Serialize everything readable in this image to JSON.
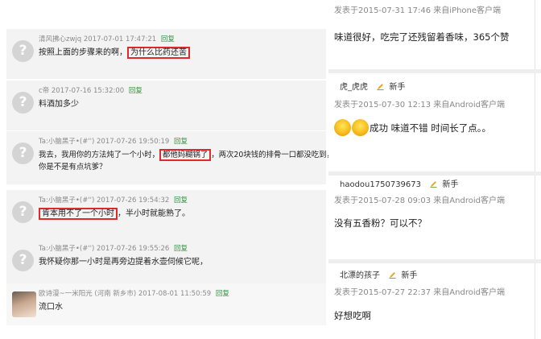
{
  "left": {
    "comments": [
      {
        "user": "清风拂心zwjq",
        "time": "2017-07-01 17:47:21",
        "reply": "回复",
        "text_before": "按照上面的步骤来的啊，",
        "highlight": "为什么比药还苦",
        "text_after": "",
        "text_line2": ""
      },
      {
        "user": "c帝",
        "time": "2017-07-16 15:32:00",
        "reply": "回复",
        "text_before": "料酒加多少",
        "highlight": "",
        "text_after": "",
        "text_line2": ""
      },
      {
        "user": "Ta:小脑黑子•(#'')",
        "time": "2017-07-26 19:50:19",
        "reply": "回复",
        "text_before": "我去，我用你的方法炖了一个小时，",
        "highlight": "都他妈糊锅了",
        "text_after": "，两次20块钱的排骨一口都没吃到，",
        "text_line2": "你是不是有点坑爹？"
      },
      {
        "user": "Ta:小脑黑子•(#'')",
        "time": "2017-07-26 19:54:32",
        "reply": "回复",
        "text_before": "",
        "highlight": "肯本用不了一个小时",
        "text_after": "，半小时就能熟了。",
        "text_line2": ""
      },
      {
        "user": "Ta:小脑黑子•(#'')",
        "time": "2017-07-26 19:55:26",
        "reply": "回复",
        "text_before": "我怀疑你那一小时是再旁边提着水壶伺候它呢，",
        "highlight": "",
        "text_after": "",
        "text_line2": ""
      },
      {
        "user": "欧诗漫~一米阳光 (河南 新乡市)",
        "time": "2017-08-01 11:50:59",
        "reply": "回复",
        "text_before": "流口水",
        "highlight": "",
        "text_after": "",
        "text_line2": ""
      }
    ]
  },
  "right": {
    "top": {
      "meta": "发表于2015-07-31 17:46  来自iPhone客户端",
      "text": "味道很好，吃完了还残留着香味，365个赞"
    },
    "comments": [
      {
        "user": "虎_虎虎",
        "level": "新手",
        "meta": "发表于2015-07-30 12:13  来自Android客户端",
        "text": "成功 味道不错 时间长了点。。"
      },
      {
        "user": "haodou1750739673",
        "level": "新手",
        "meta": "发表于2015-07-28 09:03  来自Android客户端",
        "text": "没有五香粉？可以不？"
      },
      {
        "user": "北漂的孩子",
        "level": "新手",
        "meta": "发表于2015-07-27 22:37  来自Android客户端",
        "text": "好想吃啊"
      }
    ]
  },
  "colors": {
    "highlight_border": "#e02a2a",
    "reply_link": "#2f8f3c",
    "card_bg": "#f3f3f3"
  },
  "icons": {
    "avatar_default": "question-mark",
    "level_badge": "pen-icon",
    "emoji": "laughing-emoji"
  }
}
